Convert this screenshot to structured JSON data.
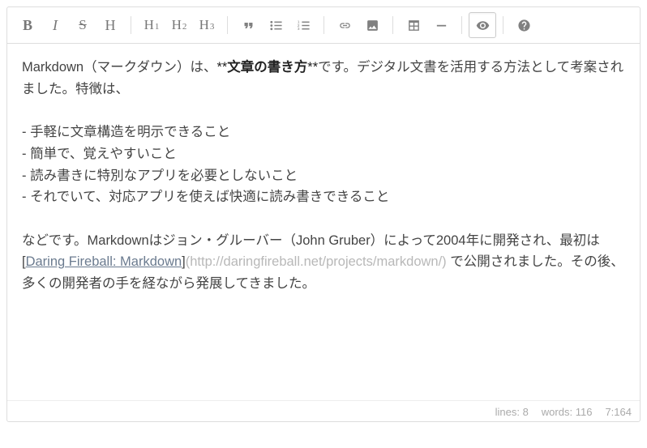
{
  "toolbar": {
    "bold": "B",
    "italic": "I",
    "strike": "S",
    "heading": "H",
    "h1": "H",
    "h1sub": "1",
    "h2": "H",
    "h2sub": "2",
    "h3": "H",
    "h3sub": "3"
  },
  "content": {
    "p1": "Markdown（マークダウン）は、",
    "p1_bold_marker_open": "**",
    "p1_bold_text": "文章の書き方",
    "p1_bold_marker_close": "**",
    "p1_after": "です。デジタル文書を活用する方法として考案されました。特徴は、",
    "li1": "- 手軽に文章構造を明示できること",
    "li2": "- 簡単で、覚えやすいこと",
    "li3": "- 読み書きに特別なアプリを必要としないこと",
    "li4": "- それでいて、対応アプリを使えば快適に読み書きできること",
    "p2a": "などです。Markdownはジョン・グルーバー（John Gruber）によって2004年に開発され、最初は ",
    "link_open": "[",
    "link_text": "Daring Fireball: Markdown",
    "link_close": "]",
    "link_url": "(http://daringfireball.net/projects/markdown/)",
    "p2b": " で公開されました。その後、多くの開発者の手を経ながら発展してきました。"
  },
  "status": {
    "lines_label": "lines:",
    "lines_value": "8",
    "words_label": "words:",
    "words_value": "116",
    "cursor": "7:164"
  }
}
